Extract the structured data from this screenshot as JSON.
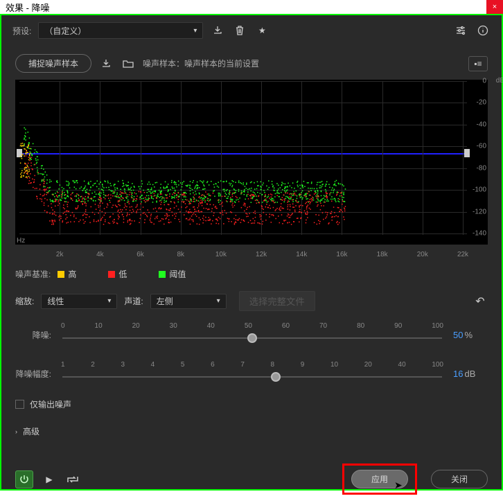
{
  "window": {
    "title": "效果 - 降噪"
  },
  "presets": {
    "label": "预设:",
    "selected": "（自定义）"
  },
  "capture": {
    "button": "捕捉噪声样本",
    "sample_label": "噪声样本：噪声样本的当前设置"
  },
  "chart_data": {
    "type": "scatter",
    "x_unit": "Hz",
    "y_unit": "dB",
    "xlim": [
      0,
      22000
    ],
    "ylim": [
      -140,
      0
    ],
    "x_ticks": [
      2000,
      4000,
      6000,
      8000,
      10000,
      12000,
      14000,
      16000,
      18000,
      20000,
      22000
    ],
    "x_tick_labels": [
      "2k",
      "4k",
      "6k",
      "8k",
      "10k",
      "12k",
      "14k",
      "16k",
      "18k",
      "20k",
      "22k"
    ],
    "y_ticks": [
      0,
      -20,
      -40,
      -60,
      -80,
      -100,
      -120,
      -140
    ],
    "threshold_line": -64,
    "series": [
      {
        "name": "高",
        "color": "#ffcc00",
        "band": {
          "start_hz": 0,
          "end_hz": 500,
          "y_center": -70,
          "spread": 18
        }
      },
      {
        "name": "低",
        "color": "#ff2020",
        "band": {
          "start_hz": 200,
          "end_hz": 16000,
          "y_center": -115,
          "spread": 15,
          "head_y": -65
        }
      },
      {
        "name": "阈值",
        "color": "#20ff20",
        "band": {
          "start_hz": 200,
          "end_hz": 16000,
          "y_center": -100,
          "spread": 10,
          "head_y": -40
        }
      }
    ]
  },
  "legend": {
    "label": "噪声基准:",
    "items": [
      {
        "name": "高",
        "color": "#ffcc00"
      },
      {
        "name": "低",
        "color": "#ff2020"
      },
      {
        "name": "阈值",
        "color": "#20ff20"
      }
    ]
  },
  "scale": {
    "label": "缩放:",
    "value": "线性"
  },
  "channel": {
    "label": "声道:",
    "value": "左侧"
  },
  "select_full": "选择完整文件",
  "slider1": {
    "label": "降噪:",
    "ticks": [
      "0",
      "10",
      "20",
      "30",
      "40",
      "50",
      "60",
      "70",
      "80",
      "90",
      "100"
    ],
    "value": 50,
    "unit": "%"
  },
  "slider2": {
    "label": "降噪幅度:",
    "ticks": [
      "1",
      "2",
      "3",
      "4",
      "5",
      "6",
      "7",
      "8",
      "9",
      "10",
      "20",
      "40",
      "100"
    ],
    "value": 16,
    "unit": "dB"
  },
  "checkbox": {
    "label": "仅输出噪声"
  },
  "advanced": {
    "label": "高级"
  },
  "footer": {
    "apply": "应用",
    "close": "关闭"
  }
}
